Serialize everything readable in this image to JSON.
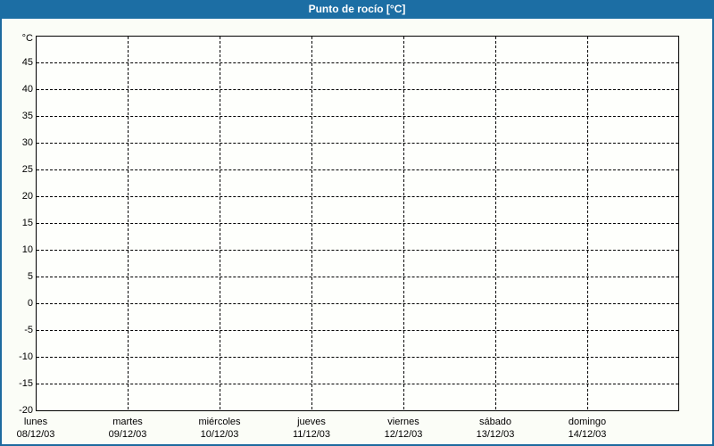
{
  "window": {
    "title": "Punto de rocío [°C]"
  },
  "colors": {
    "titlebar_bg": "#1c6ea4",
    "titlebar_text": "#ffffff",
    "frame_border": "#1d6a9f",
    "page_bg": "#fbfdf7",
    "plot_bg": "#fefffc",
    "grid": "#000000",
    "axis": "#000000",
    "text": "#000000"
  },
  "chart_data": {
    "type": "line",
    "title": "Punto de rocío [°C]",
    "ylabel": "°C",
    "ylim": [
      -20,
      50
    ],
    "ytick_step": 5,
    "yticks": [
      45,
      40,
      35,
      30,
      25,
      20,
      15,
      10,
      5,
      0,
      -5,
      -10,
      -15,
      -20
    ],
    "x_categories": [
      {
        "day": "lunes",
        "date": "08/12/03"
      },
      {
        "day": "martes",
        "date": "09/12/03"
      },
      {
        "day": "miércoles",
        "date": "10/12/03"
      },
      {
        "day": "jueves",
        "date": "11/12/03"
      },
      {
        "day": "viernes",
        "date": "12/12/03"
      },
      {
        "day": "sábado",
        "date": "13/12/03"
      },
      {
        "day": "domingo",
        "date": "14/12/03"
      }
    ],
    "series": [],
    "grid": "dashed",
    "legend_position": "none"
  }
}
